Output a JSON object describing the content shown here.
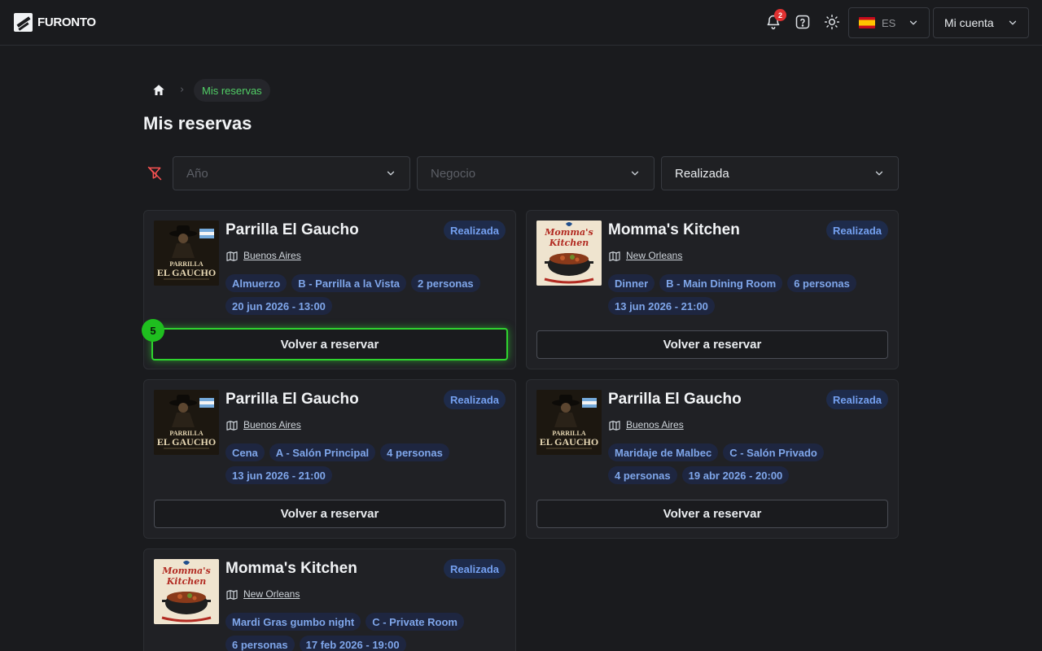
{
  "app": {
    "logo_text": "FURONTO"
  },
  "header": {
    "notifications_count": "2",
    "language_code": "ES",
    "account_label": "Mi cuenta"
  },
  "breadcrumb": {
    "current": "Mis reservas"
  },
  "page": {
    "title": "Mis reservas"
  },
  "filters": {
    "year_placeholder": "Año",
    "business_placeholder": "Negocio",
    "status_value": "Realizada"
  },
  "rebook_label": "Volver a reservar",
  "focus_step": "5",
  "reservations": [
    {
      "name": "Parrilla El Gaucho",
      "status": "Realizada",
      "city": "Buenos Aires",
      "tags": [
        "Almuerzo",
        "B - Parrilla a la Vista",
        "2 personas",
        "20 jun 2026 - 13:00"
      ]
    },
    {
      "name": "Momma's Kitchen",
      "status": "Realizada",
      "city": "New Orleans",
      "tags": [
        "Dinner",
        "B - Main Dining Room",
        "6 personas",
        "13 jun 2026 - 21:00"
      ]
    },
    {
      "name": "Parrilla El Gaucho",
      "status": "Realizada",
      "city": "Buenos Aires",
      "tags": [
        "Cena",
        "A - Salón Principal",
        "4 personas",
        "13 jun 2026 - 21:00"
      ]
    },
    {
      "name": "Parrilla El Gaucho",
      "status": "Realizada",
      "city": "Buenos Aires",
      "tags": [
        "Maridaje de Malbec",
        "C - Salón Privado",
        "4 personas",
        "19 abr 2026 - 20:00"
      ]
    },
    {
      "name": "Momma's Kitchen",
      "status": "Realizada",
      "city": "New Orleans",
      "tags": [
        "Mardi Gras gumbo night",
        "C - Private Room",
        "6 personas",
        "17 feb 2026 - 19:00"
      ]
    }
  ],
  "colors": {
    "accent_green": "#51cf66",
    "status_blue": "#74a0f0",
    "focus_green": "#2fd42f"
  },
  "icons": [
    "bell-icon",
    "help-icon",
    "sun-icon",
    "chevron-down-icon",
    "home-icon",
    "filter-off-icon",
    "map-icon"
  ]
}
